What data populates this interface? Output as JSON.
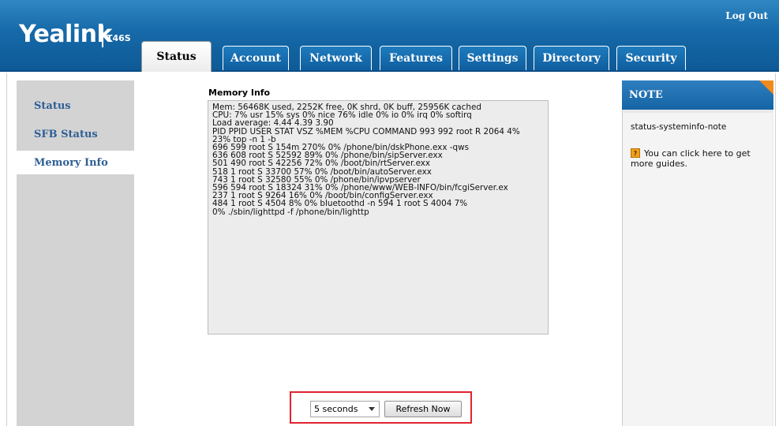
{
  "header": {
    "brand": "Yealink",
    "model": "T46S",
    "logout_label": "Log Out",
    "accent_color": "#1669a8"
  },
  "tabs": [
    {
      "label": "Status",
      "active": true
    },
    {
      "label": "Account",
      "active": false
    },
    {
      "label": "Network",
      "active": false
    },
    {
      "label": "Features",
      "active": false
    },
    {
      "label": "Settings",
      "active": false
    },
    {
      "label": "Directory",
      "active": false
    },
    {
      "label": "Security",
      "active": false
    }
  ],
  "sidebar": {
    "items": [
      {
        "label": "Status",
        "active": false
      },
      {
        "label": "SFB Status",
        "active": false
      },
      {
        "label": "Memory Info",
        "active": true
      }
    ]
  },
  "main": {
    "title": "Memory Info",
    "memory_lines": [
      "Mem: 56468K used, 2252K free, 0K shrd, 0K buff, 25956K cached",
      "CPU: 7% usr 15% sys 0% nice 76% idle 0% io 0% irq 0% softirq",
      "Load average: 4.44 4.39 3.90",
      "PID PPID USER STAT VSZ %MEM %CPU COMMAND 993 992 root R 2064 4%",
      "23% top -n 1 -b",
      "696 599 root S 154m 270% 0% /phone/bin/dskPhone.exx -qws",
      "636 608 root S 52592 89% 0% /phone/bin/sipServer.exx",
      "501 490 root S 42256 72% 0% /boot/bin/rtServer.exx",
      "518 1 root S 33700 57% 0% /boot/bin/autoServer.exx",
      "743 1 root S 32580 55% 0% /phone/bin/ipvpserver",
      "596 594 root S 18324 31% 0% /phone/www/WEB-INFO/bin/fcgiServer.ex",
      "237 1 root S 9264 16% 0% /boot/bin/configServer.exx",
      "484 1 root S 4504 8% 0% bluetoothd -n 594 1 root S 4004 7%",
      "0% ./sbin/lighttpd -f /phone/bin/lighttp"
    ],
    "refresh_interval": "5 seconds",
    "refresh_button_label": "Refresh Now",
    "highlight_color": "#e0242e"
  },
  "note": {
    "title": "NOTE",
    "id_text": "status-systeminfo-note",
    "guide_text": "You can click here to get more guides.",
    "corner_color": "#f08a1c"
  }
}
